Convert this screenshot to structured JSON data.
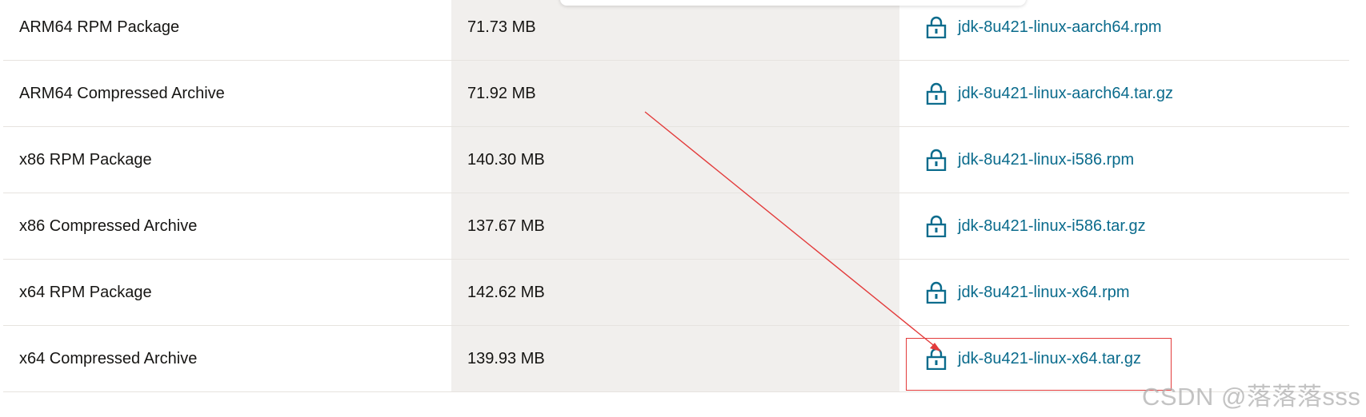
{
  "downloads": {
    "rows": [
      {
        "product": "ARM64 RPM Package",
        "size": "71.73 MB",
        "file": "jdk-8u421-linux-aarch64.rpm"
      },
      {
        "product": "ARM64 Compressed Archive",
        "size": "71.92 MB",
        "file": "jdk-8u421-linux-aarch64.tar.gz"
      },
      {
        "product": "x86 RPM Package",
        "size": "140.30 MB",
        "file": "jdk-8u421-linux-i586.rpm"
      },
      {
        "product": "x86 Compressed Archive",
        "size": "137.67 MB",
        "file": "jdk-8u421-linux-i586.tar.gz"
      },
      {
        "product": "x64 RPM Package",
        "size": "142.62 MB",
        "file": "jdk-8u421-linux-x64.rpm"
      },
      {
        "product": "x64 Compressed Archive",
        "size": "139.93 MB",
        "file": "jdk-8u421-linux-x64.tar.gz"
      }
    ],
    "icon": "lock-icon"
  },
  "annotation": {
    "highlighted_file": "jdk-8u421-linux-x64.tar.gz",
    "color": "#e33b3b"
  },
  "watermark": "CSDN @落落落sss",
  "colors": {
    "link": "#0a6b8c",
    "size_column_bg": "#f1efed",
    "divider": "#e6e3df"
  }
}
